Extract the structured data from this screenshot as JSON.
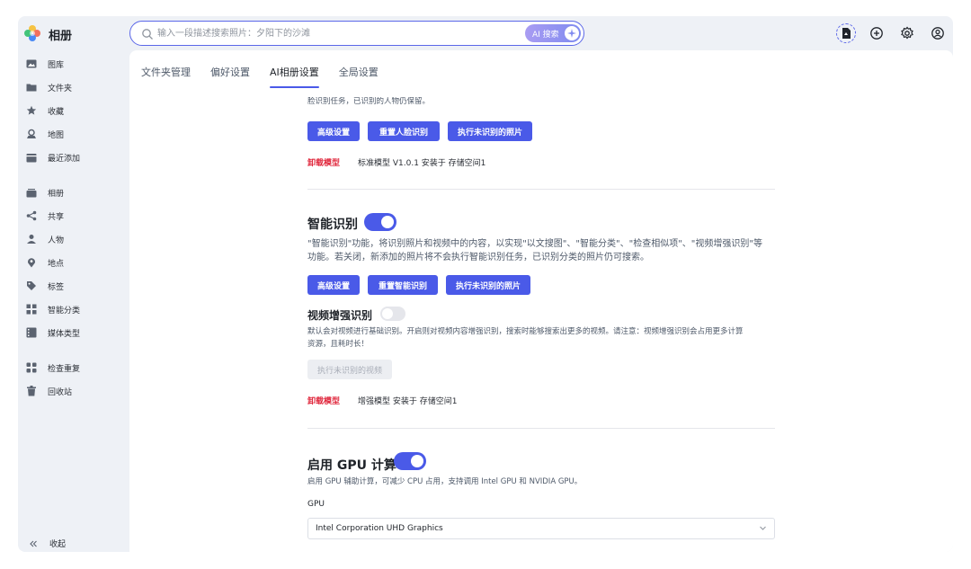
{
  "app": {
    "title": "相册"
  },
  "search": {
    "placeholder": "输入一段描述搜索照片：夕阳下的沙滩",
    "ai_button": "AI 搜索"
  },
  "top_icons": [
    "file-icon",
    "add-icon",
    "settings-icon",
    "user-icon"
  ],
  "sidebar": {
    "items": [
      {
        "label": "图库",
        "icon": "photo-icon"
      },
      {
        "label": "文件夹",
        "icon": "folder-icon"
      },
      {
        "label": "收藏",
        "icon": "star-icon"
      },
      {
        "label": "地图",
        "icon": "map-icon"
      },
      {
        "label": "最近添加",
        "icon": "recent-icon"
      },
      {
        "label": "相册",
        "icon": "album-icon"
      },
      {
        "label": "共享",
        "icon": "share-icon"
      },
      {
        "label": "人物",
        "icon": "person-icon"
      },
      {
        "label": "地点",
        "icon": "location-icon"
      },
      {
        "label": "标签",
        "icon": "tag-icon"
      },
      {
        "label": "智能分类",
        "icon": "grid-icon"
      },
      {
        "label": "媒体类型",
        "icon": "film-icon"
      },
      {
        "label": "检查重复",
        "icon": "duplicate-icon"
      },
      {
        "label": "回收站",
        "icon": "trash-icon"
      }
    ],
    "collapse_label": "收起"
  },
  "tabs": [
    {
      "label": "文件夹管理",
      "active": false
    },
    {
      "label": "偏好设置",
      "active": false
    },
    {
      "label": "AI相册设置",
      "active": true
    },
    {
      "label": "全局设置",
      "active": false
    }
  ],
  "face_section": {
    "partial_desc": "脸识别任务，已识别的人物仍保留。",
    "buttons": [
      "高级设置",
      "重置人脸识别",
      "执行未识别的照片"
    ],
    "unload_label": "卸载模型",
    "model_info": "标准模型 V1.0.1 安装于 存储空间1"
  },
  "smart_section": {
    "title": "智能识别",
    "enabled": true,
    "desc_line1": "\"智能识别\"功能，将识别照片和视频中的内容，以实现\"以文搜图\"、\"智能分类\"、\"检查相似项\"、\"视频增强识别\"等",
    "desc_line2": "功能。若关闭，新添加的照片将不会执行智能识别任务，已识别分类的照片仍可搜索。",
    "buttons": [
      "高级设置",
      "重置智能识别",
      "执行未识别的照片"
    ],
    "video_title": "视频增强识别",
    "video_enabled": false,
    "video_desc_line1": "默认会对视频进行基础识别。开启则对视频内容增强识别，搜索时能够搜索出更多的视频。请注意：视频增强识别会占用更多计算",
    "video_desc_line2": "资源，且耗时长！",
    "video_button": "执行未识别的视频",
    "unload_label": "卸载模型",
    "model_info": "增强模型 安装于 存储空间1"
  },
  "gpu_section": {
    "title": "启用 GPU 计算",
    "enabled": true,
    "desc": "启用 GPU 辅助计算，可减少 CPU 占用，支持调用 Intel GPU 和 NVIDIA GPU。",
    "field_label": "GPU",
    "selected": "Intel Corporation UHD Graphics"
  },
  "colors": {
    "accent": "#4a5ae8",
    "danger": "#e0283d",
    "background": "#eef1f6"
  }
}
